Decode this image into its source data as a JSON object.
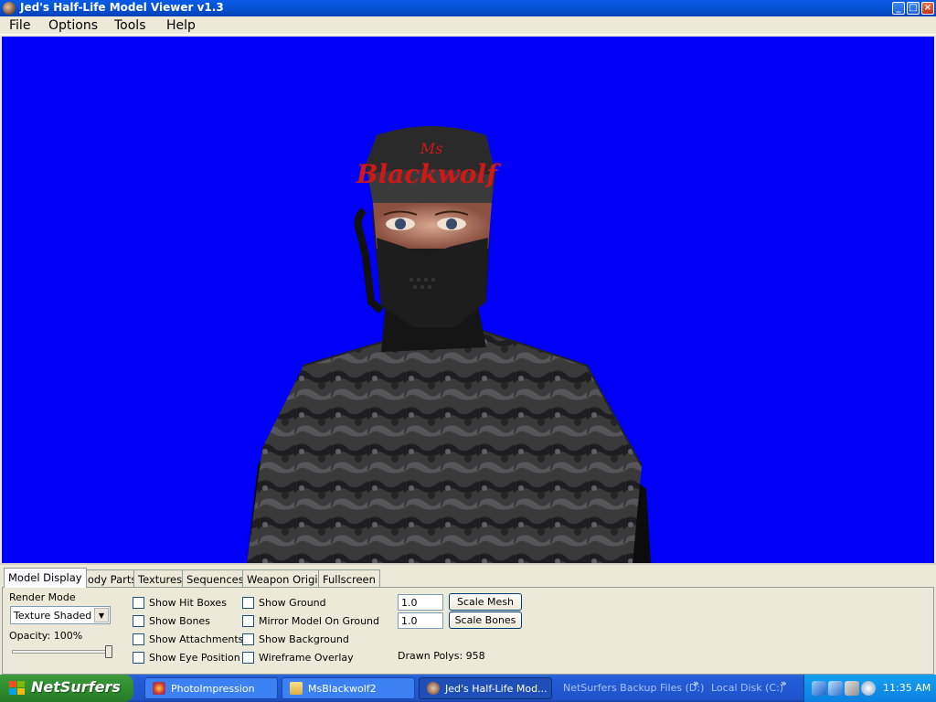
{
  "window": {
    "title": "Jed's Half-Life Model Viewer v1.3",
    "minimize_glyph": "_",
    "maximize_glyph": "□",
    "close_glyph": "×"
  },
  "menubar": {
    "items": [
      "File",
      "Options",
      "Tools",
      "Help"
    ]
  },
  "viewport": {
    "background_color": "#0000f8",
    "model_hat_text_line1": "Ms",
    "model_hat_text_line2": "Blackwolf"
  },
  "tabs": [
    {
      "label": "Model Display",
      "active": true
    },
    {
      "label": "Body Parts",
      "active": false
    },
    {
      "label": "Textures",
      "active": false
    },
    {
      "label": "Sequences",
      "active": false
    },
    {
      "label": "Weapon Origin",
      "active": false
    },
    {
      "label": "Fullscreen",
      "active": false
    }
  ],
  "model_display": {
    "render_mode_label": "Render Mode",
    "render_mode_value": "Texture Shaded",
    "opacity_label": "Opacity: 100%",
    "opacity_value": 1.0,
    "checkboxes_col1": [
      {
        "label": "Show Hit Boxes",
        "checked": false
      },
      {
        "label": "Show Bones",
        "checked": false
      },
      {
        "label": "Show Attachments",
        "checked": false
      },
      {
        "label": "Show Eye Position",
        "checked": false
      }
    ],
    "checkboxes_col2": [
      {
        "label": "Show Ground",
        "checked": false
      },
      {
        "label": "Mirror Model On Ground",
        "checked": false
      },
      {
        "label": "Show Background",
        "checked": false
      },
      {
        "label": "Wireframe Overlay",
        "checked": false
      }
    ],
    "scale_mesh_value": "1.0",
    "scale_mesh_button": "Scale Mesh",
    "scale_bones_value": "1.0",
    "scale_bones_button": "Scale Bones",
    "drawn_polys": "Drawn Polys: 958"
  },
  "taskbar": {
    "start_label": "NetSurfers",
    "tasks": [
      {
        "label": "PhotoImpression",
        "active": false,
        "icon": "photoimpression-icon"
      },
      {
        "label": "MsBlackwolf2",
        "active": false,
        "icon": "folder-icon"
      },
      {
        "label": "Jed's Half-Life Mod...",
        "active": true,
        "icon": "hlmv-icon"
      }
    ],
    "toolbars": [
      "NetSurfers Backup Files (D:)",
      "Local Disk (C:)"
    ],
    "chevron": "»",
    "clock": "11:35 AM"
  }
}
